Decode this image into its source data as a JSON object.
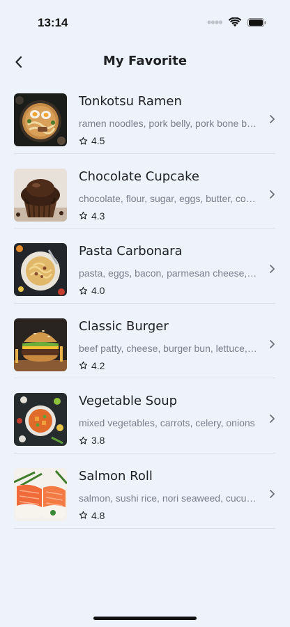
{
  "status_bar": {
    "time": "13:14",
    "icons": [
      "signal-icon",
      "wifi-icon",
      "battery-icon"
    ]
  },
  "header": {
    "back_icon": "chevron-left-icon",
    "title": "My Favorite"
  },
  "favorites": [
    {
      "title": "Tonkotsu Ramen",
      "ingredients": "ramen noodles, pork belly, pork bone broth, eggs",
      "rating": "4.5",
      "image": "ramen"
    },
    {
      "title": "Chocolate Cupcake",
      "ingredients": "chocolate, flour, sugar, eggs, butter, cocoa",
      "rating": "4.3",
      "image": "cupcake"
    },
    {
      "title": "Pasta Carbonara",
      "ingredients": "pasta, eggs, bacon, parmesan cheese, pepper",
      "rating": "4.0",
      "image": "pasta"
    },
    {
      "title": "Classic Burger",
      "ingredients": "beef patty, cheese, burger bun, lettuce, tomato",
      "rating": "4.2",
      "image": "burger"
    },
    {
      "title": "Vegetable Soup",
      "ingredients": "mixed vegetables, carrots, celery, onions",
      "rating": "3.8",
      "image": "soup"
    },
    {
      "title": "Salmon Roll",
      "ingredients": "salmon, sushi rice, nori seaweed, cucumber",
      "rating": "4.8",
      "image": "salmon"
    }
  ],
  "colors": {
    "background": "#eef2fb",
    "title_text": "#1f2024",
    "secondary_text": "#7b7f8c",
    "divider": "#dcdfe6"
  }
}
